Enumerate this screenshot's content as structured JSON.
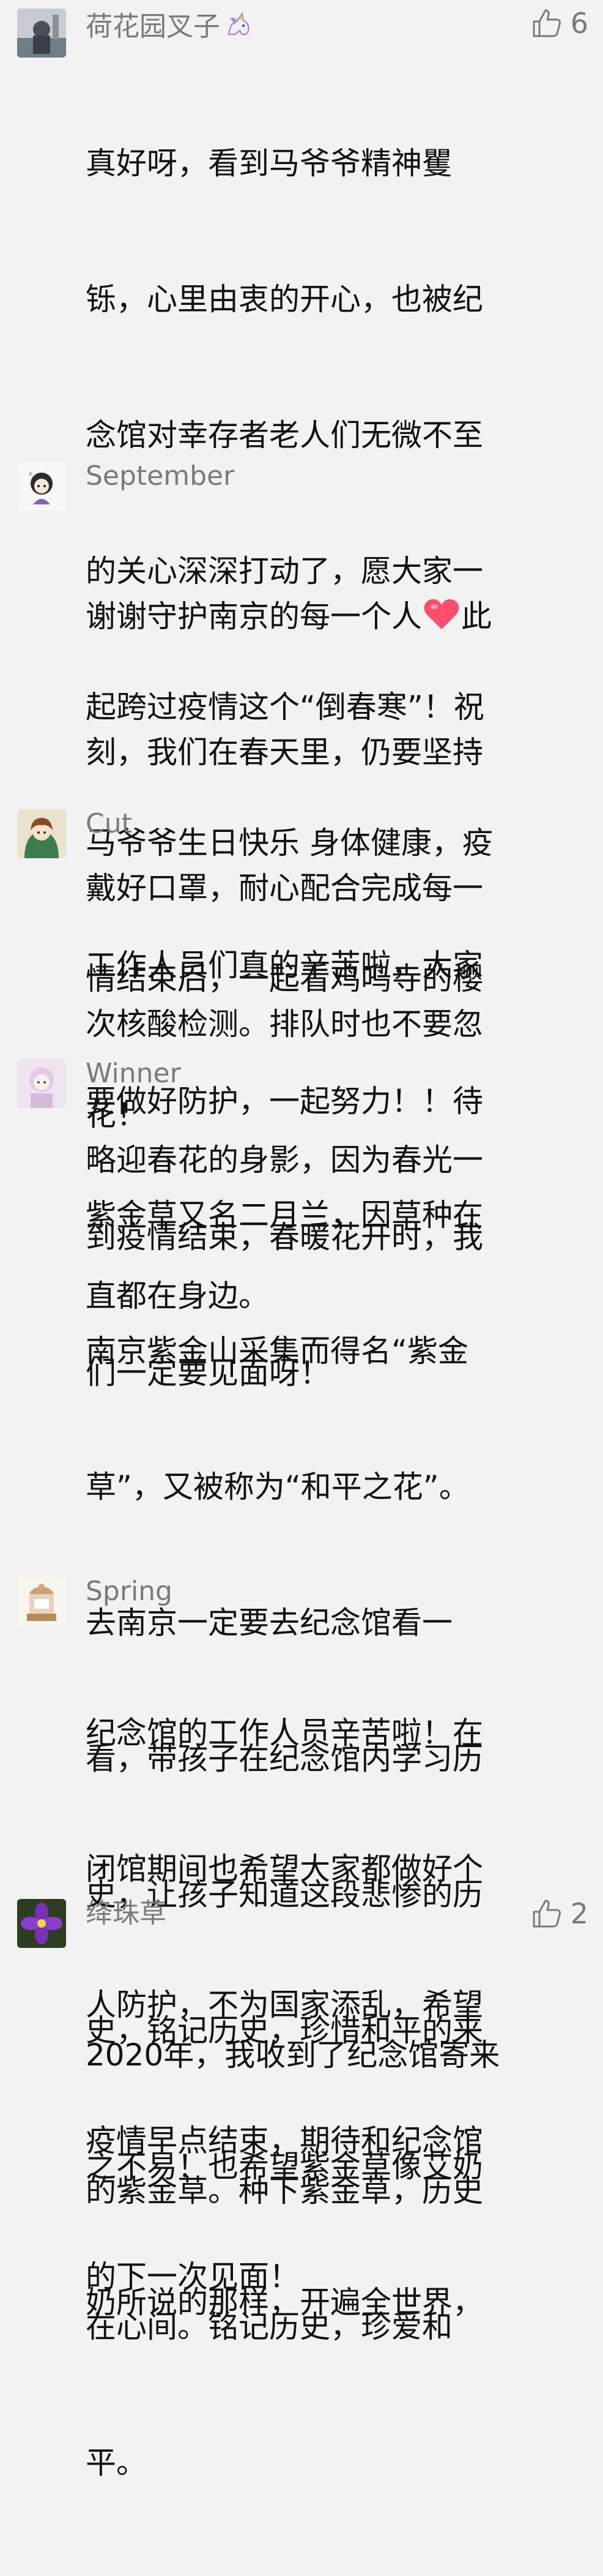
{
  "comments": [
    {
      "nickname": "荷花园叉子",
      "like_count": "6",
      "line1": "真好呀，看到马爷爷精神矍",
      "line2": "铄，心里由衷的开心，也被纪",
      "line3": "念馆对幸存者老人们无微不至",
      "line4": "的关心深深打动了，愿大家一",
      "line5": "起跨过疫情这个“倒春寒”！祝",
      "line6": "马爷爷生日快乐 身体健康，疫",
      "line7": "情结束后，一起看鸡鸣寺的樱",
      "line8": "花！"
    },
    {
      "nickname": "September",
      "line1a": "谢谢守护南京的每一个人",
      "line1b": "此",
      "line2": "刻，我们在春天里，仍要坚持",
      "line3": "戴好口罩，耐心配合完成每一",
      "line4": "次核酸检测。排队时也不要忽",
      "line5": "略迎春花的身影，因为春光一",
      "line6": "直都在身边。"
    },
    {
      "nickname": "Cut",
      "line1": "工作人员们真的辛苦啦，大家",
      "line2": "要做好防护，一起努力！！待",
      "line3": "到疫情结束，春暖花开时，我",
      "line4": "们一定要见面呀！"
    },
    {
      "nickname": "Winner",
      "line1": "紫金草又名二月兰，因草种在",
      "line2": "南京紫金山采集而得名“紫金",
      "line3": "草”，又被称为“和平之花”。",
      "line4": "去南京一定要去纪念馆看一",
      "line5": "看，带孩子在纪念馆内学习历",
      "line6": "史，让孩子知道这段悲惨的历",
      "line7": "史，铭记历史，珍惜和平的来",
      "line8": "之不易！也希望紫金草像艾奶",
      "line9": "奶所说的那样，开遍全世界，"
    },
    {
      "nickname": "Spring",
      "line1": "纪念馆的工作人员辛苦啦！在",
      "line2": "闭馆期间也希望大家都做好个",
      "line3": "人防护，不为国家添乱，希望",
      "line4": "疫情早点结束，期待和纪念馆",
      "line5": "的下一次见面！"
    },
    {
      "nickname": "绛珠草",
      "like_count": "2",
      "line1": "2020年，我收到了纪念馆寄来",
      "line2": "的紫金草。种下紫金草，历史",
      "line3": "在心间。铭记历史，珍爱和",
      "line4": "平。"
    }
  ],
  "colors": {
    "background": "#f2f2f2",
    "nickname": "#7a7a7a",
    "content": "#111111",
    "heart": "#ff4d6d",
    "purple_flower": "#7a2fb8"
  },
  "icons": {
    "like": "thumbs-up-icon",
    "heart": "heart-emoji-icon",
    "unicorn": "unicorn-emoji-icon"
  }
}
